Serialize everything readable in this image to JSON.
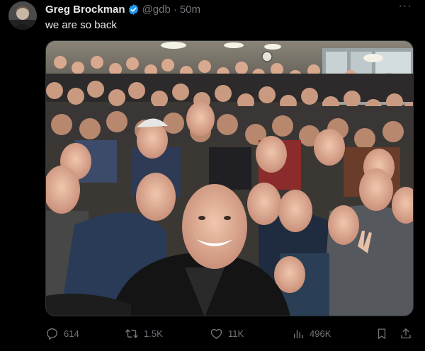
{
  "tweet": {
    "author_name": "Greg Brockman",
    "handle": "@gdb",
    "separator": "·",
    "time": "50m",
    "text": "we are so back",
    "more_label": "···"
  },
  "icons": {
    "avatar": "author-avatar",
    "verified": "verified-badge-icon",
    "reply": "reply-icon",
    "retweet": "retweet-icon",
    "like": "heart-icon",
    "views": "views-bar-chart-icon",
    "bookmark": "bookmark-icon",
    "share": "share-icon"
  },
  "metrics": {
    "replies": "614",
    "retweets": "1.5K",
    "likes": "11K",
    "views": "496K"
  },
  "colors": {
    "background": "#000000",
    "primary_text": "#e7e9ea",
    "secondary_text": "#71767b",
    "verified_blue": "#1d9bf0"
  }
}
